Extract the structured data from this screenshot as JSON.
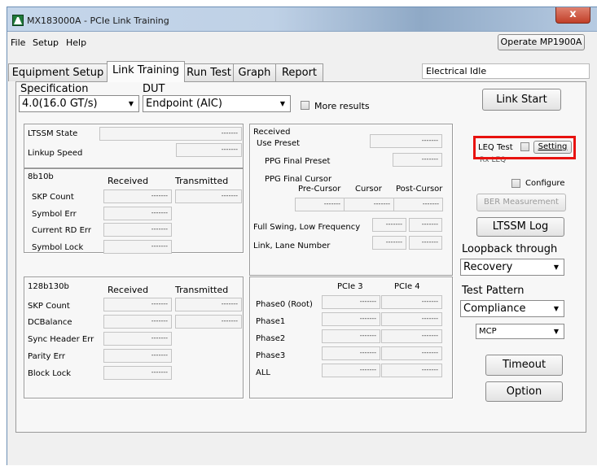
{
  "window": {
    "title": "MX183000A - PCIe Link Training",
    "close_label": "x"
  },
  "menu": {
    "items": [
      "File",
      "Setup",
      "Help"
    ],
    "operate_button": "Operate MP1900A"
  },
  "tabs": [
    "Equipment Setup",
    "Link Training",
    "Run Test",
    "Graph",
    "Report"
  ],
  "active_tab": "Link Training",
  "status": "Electrical Idle",
  "top_controls": {
    "spec_label": "Specification",
    "spec_value": "4.0(16.0 GT/s)",
    "dut_label": "DUT",
    "dut_value": "Endpoint (AIC)",
    "more_results": "More results"
  },
  "ltssm": {
    "state_label": "LTSSM State",
    "state_value": "-------",
    "linkup_label": "Linkup Speed",
    "linkup_value": "-------"
  },
  "enc8b10b": {
    "title": "8b10b",
    "col_received": "Received",
    "col_transmitted": "Transmitted",
    "rows": [
      {
        "label": "SKP Count",
        "received": "-------",
        "transmitted": "-------"
      },
      {
        "label": "Symbol Err",
        "received": "-------"
      },
      {
        "label": "Current RD Err",
        "received": "-------"
      },
      {
        "label": "Symbol Lock",
        "received": "-------"
      }
    ]
  },
  "enc128b130b": {
    "title": "128b130b",
    "col_received": "Received",
    "col_transmitted": "Transmitted",
    "rows": [
      {
        "label": "SKP Count",
        "received": "-------",
        "transmitted": "-------"
      },
      {
        "label": "DCBalance",
        "received": "-------",
        "transmitted": "-------"
      },
      {
        "label": "Sync Header Err",
        "received": "-------"
      },
      {
        "label": "Parity Err",
        "received": "-------"
      },
      {
        "label": "Block Lock",
        "received": "-------"
      }
    ]
  },
  "received_panel": {
    "title": "Received",
    "use_preset_label": "Use Preset",
    "use_preset_value": "-------",
    "ppg_final_preset_label": "PPG Final Preset",
    "ppg_final_preset_value": "-------",
    "ppg_final_cursor_label": "PPG Final Cursor",
    "cursor_headers": [
      "Pre-Cursor",
      "Cursor",
      "Post-Cursor"
    ],
    "cursor_values": [
      "-------",
      "-------",
      "-------"
    ],
    "full_swing_label": "Full Swing, Low Frequency",
    "full_swing_values": [
      "-------",
      "-------"
    ],
    "link_lane_label": "Link, Lane Number",
    "link_lane_values": [
      "-------",
      "-------"
    ]
  },
  "phase_panel": {
    "headers": [
      "PCIe 3",
      "PCIe 4"
    ],
    "rows": [
      {
        "label": "Phase0 (Root)",
        "values": [
          "-------",
          "-------"
        ]
      },
      {
        "label": "Phase1",
        "values": [
          "-------",
          "-------"
        ]
      },
      {
        "label": "Phase2",
        "values": [
          "-------",
          "-------"
        ]
      },
      {
        "label": "Phase3",
        "values": [
          "-------",
          "-------"
        ]
      },
      {
        "label": "ALL",
        "values": [
          "-------",
          "-------"
        ]
      }
    ]
  },
  "right_panel": {
    "link_start": "Link Start",
    "leq_test": "LEQ Test",
    "setting": "Setting",
    "rx_leq": "Rx LEQ",
    "configure": "Configure",
    "ber_measurement": "BER Measurement",
    "ltssm_log": "LTSSM Log",
    "loopback_label": "Loopback through",
    "loopback_value": "Recovery",
    "test_pattern_label": "Test Pattern",
    "test_pattern_value": "Compliance",
    "pattern_sub_value": "MCP",
    "timeout": "Timeout",
    "option": "Option"
  }
}
